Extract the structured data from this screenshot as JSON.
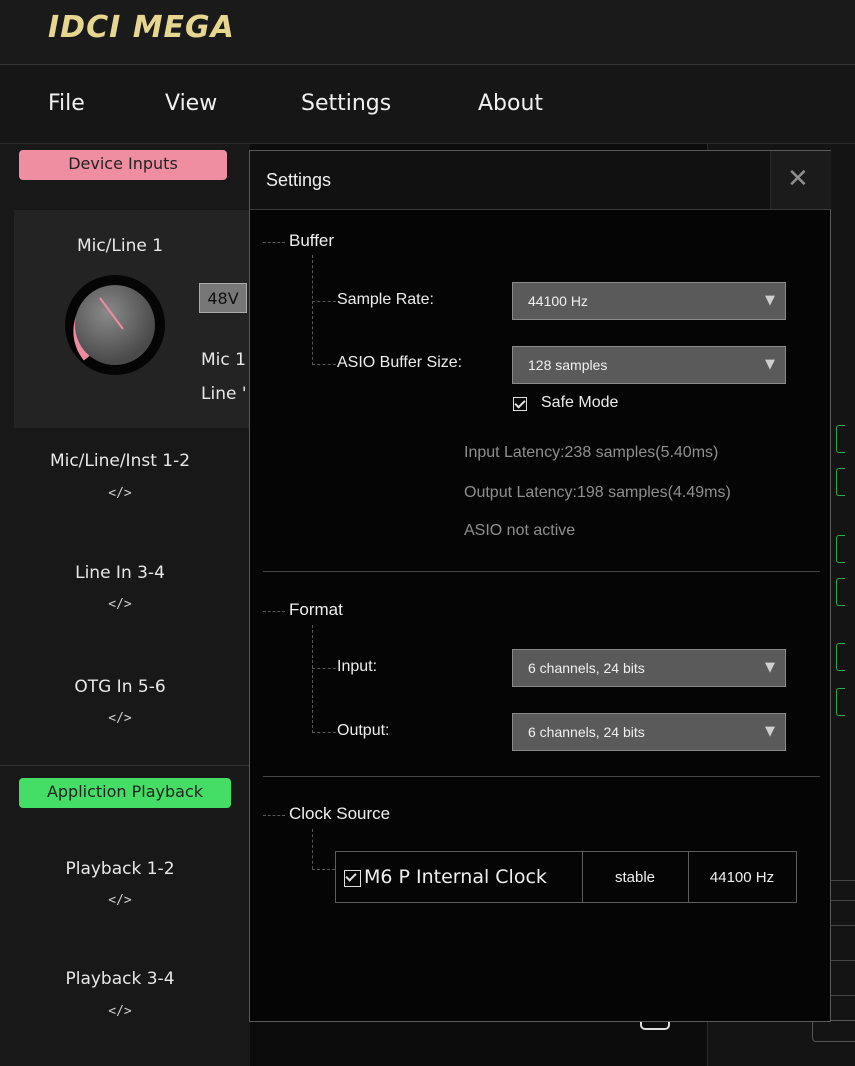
{
  "app": {
    "logo": "IDCI MEGA"
  },
  "menu": [
    "File",
    "View",
    "Settings",
    "About"
  ],
  "left_panel": {
    "device_inputs_tag": "Device Inputs",
    "mic_line_1": "Mic/Line 1",
    "btn_48v": "48V",
    "mic_partial": "Mic 1",
    "line_partial": "Line '",
    "channels": [
      {
        "name": "Mic/Line/Inst 1-2",
        "code": "</>"
      },
      {
        "name": "Line In 3-4",
        "code": "</>"
      },
      {
        "name": "OTG In 5-6",
        "code": "</>"
      }
    ],
    "playback_tag": "Appliction Playback",
    "playback": [
      {
        "name": "Playback 1-2",
        "code": "</>"
      },
      {
        "name": "Playback 3-4",
        "code": "</>"
      }
    ]
  },
  "dialog": {
    "title": "Settings",
    "close_glyph": "✕",
    "buffer": {
      "heading": "Buffer",
      "sample_rate_label": "Sample Rate:",
      "sample_rate_value": "44100 Hz",
      "asio_buffer_label": "ASIO Buffer Size:",
      "asio_buffer_value": "128 samples",
      "safe_mode_label": "Safe Mode",
      "safe_mode_checked": true,
      "input_latency": "Input Latency:238 samples(5.40ms)",
      "output_latency": "Output Latency:198 samples(4.49ms)",
      "asio_status": "ASIO not active"
    },
    "format": {
      "heading": "Format",
      "input_label": "Input:",
      "input_value": "6 channels, 24 bits",
      "output_label": "Output:",
      "output_value": "6 channels, 24 bits"
    },
    "clock": {
      "heading": "Clock Source",
      "source_name": "M6 P Internal Clock",
      "source_checked": true,
      "status": "stable",
      "rate": "44100 Hz"
    }
  },
  "colors": {
    "device_inputs_tag": "#ef8ea0",
    "playback_tag": "#44dd66",
    "knob_arc": "#f08aa0",
    "logo": "#e6d690"
  }
}
